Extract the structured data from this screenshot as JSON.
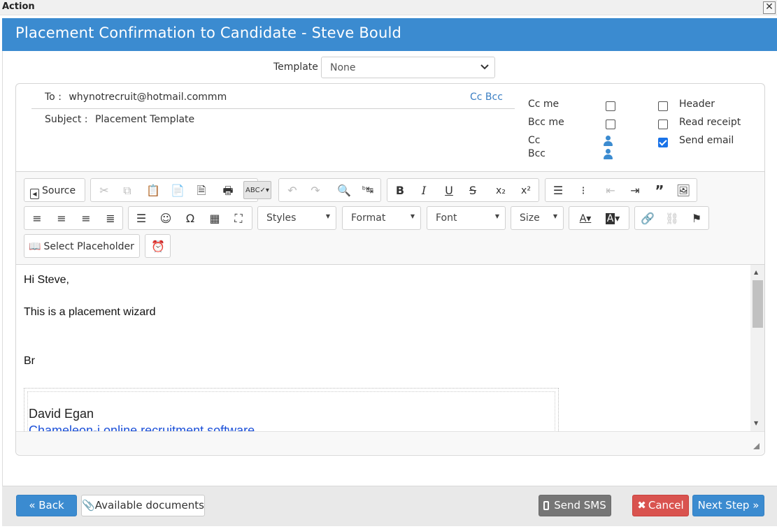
{
  "window": {
    "title": "Action",
    "close_glyph": "✕"
  },
  "header": {
    "title": "Placement Confirmation to Candidate - Steve Bould"
  },
  "template": {
    "label": "Template",
    "selected": "None"
  },
  "email": {
    "to_label": "To :",
    "to_value": "whynotrecruit@hotmail.commm",
    "cc_bcc_link": "Cc Bcc",
    "subject_label": "Subject :",
    "subject_value": "Placement Template"
  },
  "options": {
    "cc_me": {
      "label": "Cc me",
      "checked": false
    },
    "bcc_me": {
      "label": "Bcc me",
      "checked": false
    },
    "cc": {
      "label": "Cc"
    },
    "bcc": {
      "label": "Bcc"
    },
    "header": {
      "label": "Header",
      "checked": false
    },
    "read_receipt": {
      "label": "Read receipt",
      "checked": false
    },
    "send_email": {
      "label": "Send email",
      "checked": true
    }
  },
  "toolbar": {
    "source": "Source",
    "styles": "Styles",
    "format": "Format",
    "font": "Font",
    "size": "Size",
    "select_placeholder": "Select Placeholder"
  },
  "editor": {
    "line1": "Hi Steve,",
    "line2": "This is a placement wizard",
    "line3": "Br",
    "signature_name": "David Egan",
    "signature_link": "Chameleon-i online recruitment software"
  },
  "footer": {
    "back": "« Back",
    "available_documents": "Available documents",
    "send_sms": "Send SMS",
    "cancel": "Cancel",
    "next_step": "Next Step »"
  },
  "colors": {
    "brand_blue": "#3b8bd0",
    "cancel_red": "#d9534f",
    "sms_gray": "#767676",
    "link_blue": "#1a4fd8"
  }
}
